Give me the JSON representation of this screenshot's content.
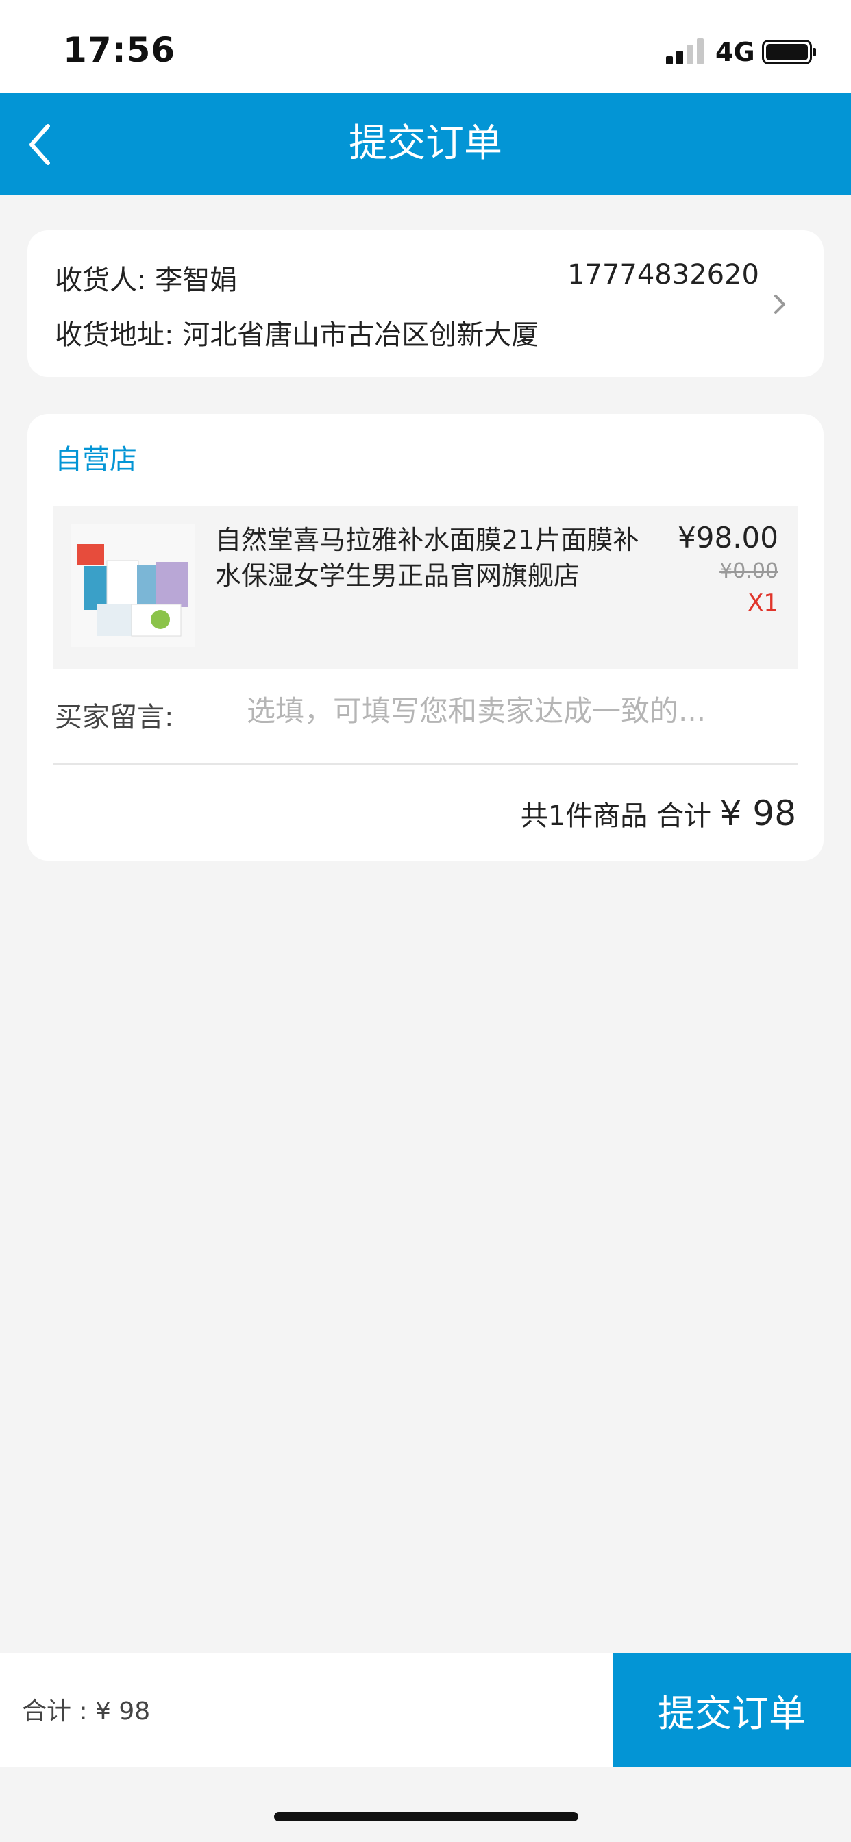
{
  "status_bar": {
    "time": "17:56",
    "network": "4G"
  },
  "nav": {
    "title": "提交订单",
    "back_icon": "chevron-left-icon"
  },
  "address": {
    "receiver_label": "收货人:",
    "receiver_name": "李智娟",
    "phone": "17774832620",
    "address_label": "收货地址:",
    "address": "河北省唐山市古冶区创新大厦"
  },
  "order": {
    "store_name": "自营店",
    "product": {
      "name": "自然堂喜马拉雅补水面膜21片面膜补水保湿女学生男正品官网旗舰店",
      "price": "¥98.00",
      "original_price": "¥0.00",
      "quantity": "X1"
    },
    "message_label": "买家留言:",
    "message_placeholder": "选填，可填写您和卖家达成一致的...",
    "summary_count": "共1件商品",
    "summary_total_label": "合计",
    "summary_total": "¥ 98"
  },
  "bottom": {
    "total_label": "合计 : ¥ 98",
    "submit_label": "提交订单"
  },
  "colors": {
    "accent": "#0395d5",
    "quantity": "#e0352b"
  }
}
